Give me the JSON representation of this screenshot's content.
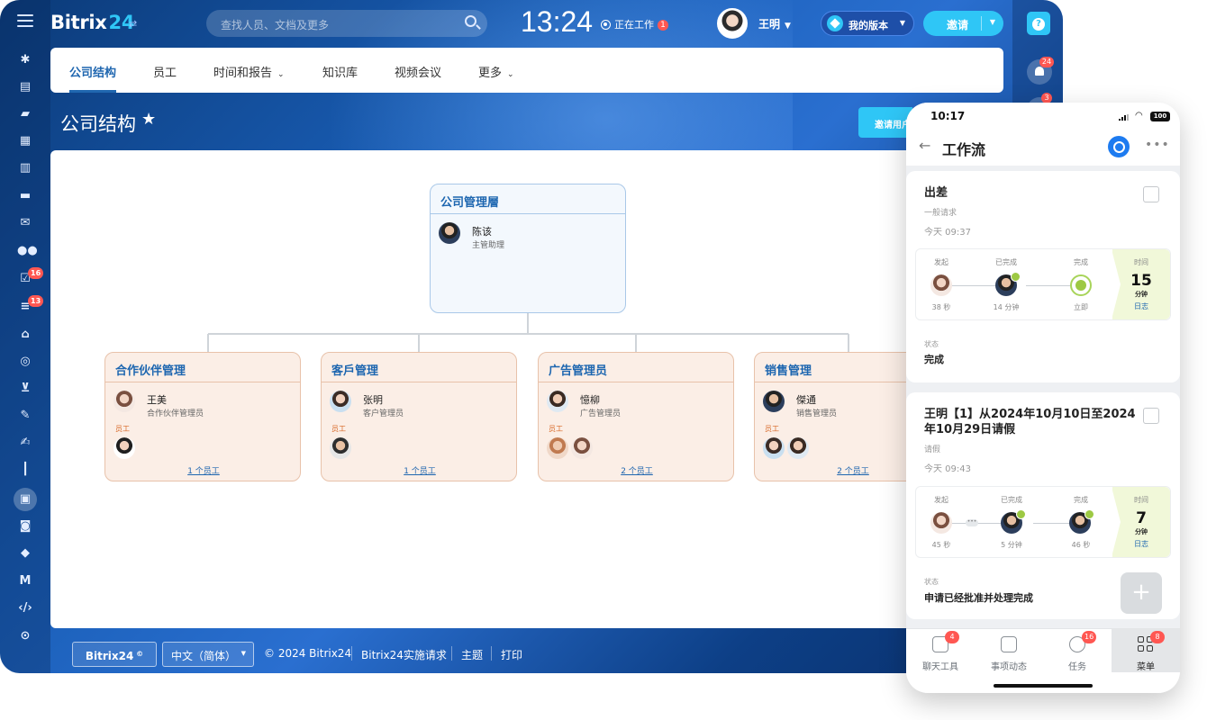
{
  "app": {
    "logo_text": "Bitrix",
    "logo_num": "24",
    "search_placeholder": "查找人员、文档及更多",
    "clock": "13:24",
    "work_status": "正在工作",
    "work_badge": "1",
    "user_name": "王明",
    "version_label": "我的版本",
    "invite_label": "邀请",
    "help_label": "?",
    "notifications_badge": "24",
    "chat_badge": "3"
  },
  "left_rail": {
    "badges": {
      "tasks": "16",
      "feed": "13"
    },
    "icons": [
      "menu-icon",
      "pulse-icon",
      "news-icon",
      "chat-icon",
      "calendar-icon",
      "docs-icon",
      "drive-icon",
      "mail-icon",
      "group-icon",
      "tasks-icon",
      "filter-icon",
      "bank-icon",
      "target-icon",
      "cart-icon",
      "sign-icon",
      "pen-icon",
      "analytics-icon",
      "company-icon",
      "robot-icon",
      "market-icon",
      "automation-icon",
      "code-icon",
      "more-icon"
    ]
  },
  "tabs": [
    {
      "label": "公司结构",
      "active": true
    },
    {
      "label": "员工"
    },
    {
      "label": "时间和报告",
      "has_menu": true
    },
    {
      "label": "知识库"
    },
    {
      "label": "视频会议"
    },
    {
      "label": "更多",
      "has_menu": true
    }
  ],
  "page": {
    "title": "公司结构",
    "invite_users": "邀请用户"
  },
  "org": {
    "root": {
      "title": "公司管理層",
      "head_name": "陈该",
      "head_role": "主管助理"
    },
    "departments": [
      {
        "title": "合作伙伴管理",
        "head_name": "王美",
        "head_role": "合作伙伴管理员",
        "emp_label": "员工",
        "count": "1 个员工"
      },
      {
        "title": "客戶管理",
        "head_name": "张明",
        "head_role": "客户管理员",
        "emp_label": "员工",
        "count": "1 个员工"
      },
      {
        "title": "广告管理员",
        "head_name": "憶柳",
        "head_role": "广告管理员",
        "emp_label": "员工",
        "count": "2 个员工"
      },
      {
        "title": "销售管理",
        "head_name": "傑通",
        "head_role": "销售管理员",
        "emp_label": "员工",
        "count": "2 个员工"
      }
    ]
  },
  "footer": {
    "logo": "Bitrix24",
    "language": "中文（简体）",
    "copyright": "© 2024 Bitrix24",
    "link_1": "Bitrix24实施请求",
    "link_2": "主题",
    "link_3": "打印"
  },
  "phone": {
    "time": "10:17",
    "battery": "100",
    "title": "工作流",
    "cards": [
      {
        "title": "出差",
        "type": "一般请求",
        "time": "今天 09:37",
        "steps": [
          {
            "label": "发起",
            "duration": "38 秒"
          },
          {
            "label": "已完成",
            "duration": "14 分钟"
          },
          {
            "label": "完成",
            "duration": "立即"
          }
        ],
        "time_label": "时间",
        "time_value": "15",
        "time_unit": "分钟",
        "log_label": "日志",
        "state_label": "状态",
        "state_value": "完成"
      },
      {
        "title": "王明【1】从2024年10月10日至2024年10月29日请假",
        "type": "请假",
        "time": "今天 09:43",
        "steps": [
          {
            "label": "发起",
            "duration": "45 秒"
          },
          {
            "label": "已完成",
            "duration": "5 分钟"
          },
          {
            "label": "完成",
            "duration": "46 秒"
          }
        ],
        "time_label": "时间",
        "time_value": "7",
        "time_unit": "分钟",
        "log_label": "日志",
        "state_label": "状态",
        "state_value": "申请已经批准并处理完成"
      }
    ],
    "tabbar": [
      {
        "label": "聊天工具",
        "badge": "4"
      },
      {
        "label": "事项动态",
        "badge": ""
      },
      {
        "label": "任务",
        "badge": "16"
      },
      {
        "label": "菜单",
        "badge": "8",
        "active": true
      }
    ]
  },
  "colors": {
    "accent": "#2fc6f6",
    "link": "#2067b0",
    "badge": "#ff5752",
    "root_node": "#f3f8fd",
    "dept_node": "#fbeee6"
  }
}
